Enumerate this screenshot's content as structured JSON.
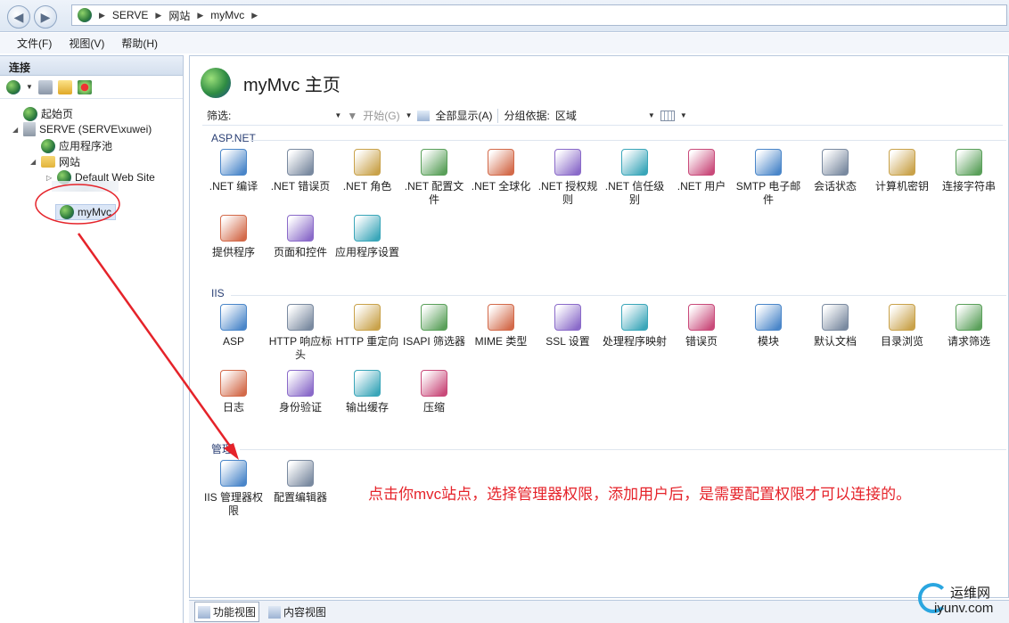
{
  "address": {
    "crumbs": [
      "SERVE",
      "网站",
      "myMvc"
    ],
    "back_icon": "back-arrow",
    "forward_icon": "forward-arrow"
  },
  "menu": [
    "文件(F)",
    "视图(V)",
    "帮助(H)"
  ],
  "left_pane": {
    "header": "连接",
    "tree": {
      "start_page": "起始页",
      "server": "SERVE (SERVE\\xuwei)",
      "app_pools": "应用程序池",
      "sites": "网站",
      "default_site": "Default Web Site",
      "mymvc": "myMvc"
    }
  },
  "main": {
    "title": "myMvc 主页",
    "filter_label": "筛选:",
    "go_label": "开始(G)",
    "show_all_label": "全部显示(A)",
    "group_by_label": "分组依据:",
    "group_by_value": "区域",
    "groups": {
      "aspnet": {
        "label": "ASP.NET",
        "items": [
          ".NET 编译",
          ".NET 错误页",
          ".NET 角色",
          ".NET 配置文件",
          ".NET 全球化",
          ".NET 授权规则",
          ".NET 信任级别",
          ".NET 用户",
          "SMTP 电子邮件",
          "会话状态",
          "计算机密钥",
          "连接字符串",
          "提供程序",
          "页面和控件",
          "应用程序设置"
        ]
      },
      "iis": {
        "label": "IIS",
        "items": [
          "ASP",
          "HTTP 响应标头",
          "HTTP 重定向",
          "ISAPI 筛选器",
          "MIME 类型",
          "SSL 设置",
          "处理程序映射",
          "错误页",
          "模块",
          "默认文档",
          "目录浏览",
          "请求筛选",
          "日志",
          "身份验证",
          "输出缓存",
          "压缩"
        ]
      },
      "management": {
        "label": "管理",
        "items": [
          "IIS 管理器权限",
          "配置编辑器"
        ]
      }
    },
    "annotation": "点击你mvc站点，选择管理器权限，添加用户后，是需要配置权限才可以连接的。"
  },
  "bottom_tabs": [
    "功能视图",
    "内容视图"
  ],
  "watermark": {
    "line1": "运维网",
    "line2": "iyunv.com"
  },
  "colors": {
    "annotation": "#e5232a",
    "group_label": "#2a3f74",
    "watermark": "#2aa6e0"
  }
}
